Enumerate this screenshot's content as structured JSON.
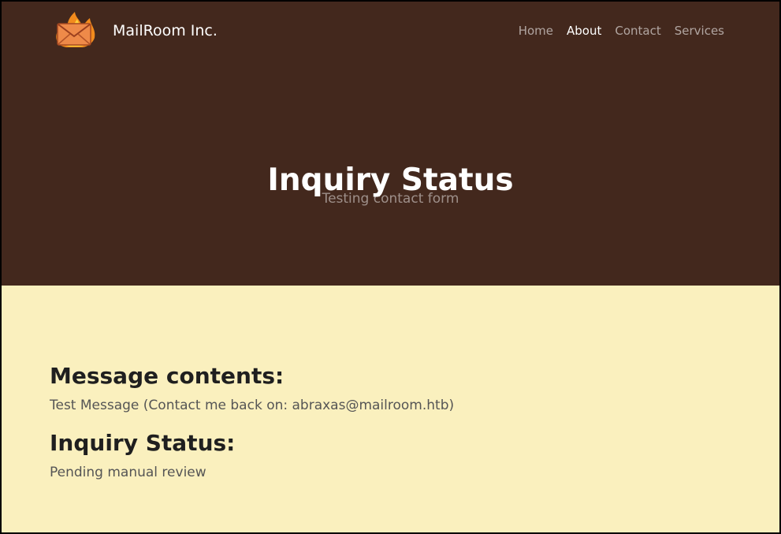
{
  "header": {
    "brand_name": "MailRoom Inc.",
    "logo_icon": "flaming-envelope-icon",
    "nav": [
      {
        "label": "Home",
        "active": false
      },
      {
        "label": "About",
        "active": true
      },
      {
        "label": "Contact",
        "active": false
      },
      {
        "label": "Services",
        "active": false
      }
    ]
  },
  "hero": {
    "title": "Inquiry Status",
    "subtitle": "Testing contact form"
  },
  "content": {
    "message_heading": "Message contents:",
    "message_text": "Test Message (Contact me back on: abraxas@mailroom.htb)",
    "status_heading": "Inquiry Status:",
    "status_text": "Pending manual review"
  },
  "colors": {
    "hero_background": "#43281d",
    "page_background": "#faf0be",
    "heading_text": "#1f1f1f",
    "muted_text": "#555555"
  }
}
